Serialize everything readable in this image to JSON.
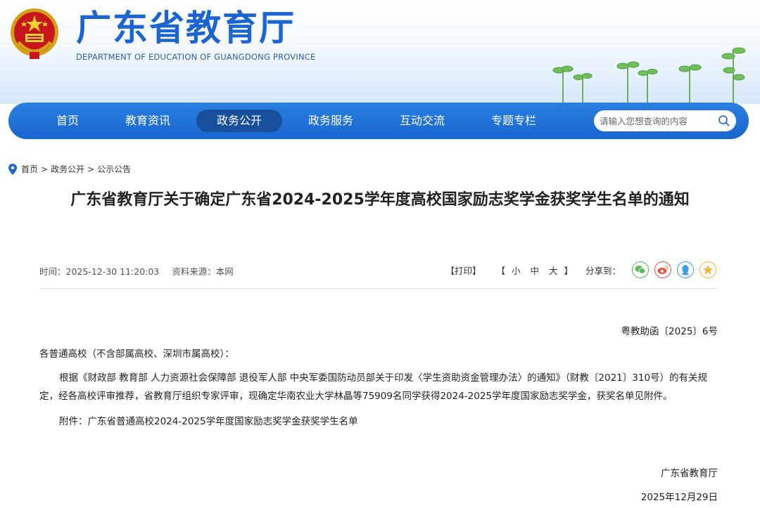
{
  "header": {
    "title": "广东省教育厅",
    "subtitle": "DEPARTMENT OF EDUCATION OF GUANGDONG PROVINCE"
  },
  "nav": {
    "items": [
      {
        "label": "首页"
      },
      {
        "label": "教育资讯"
      },
      {
        "label": "政务公开"
      },
      {
        "label": "政务服务"
      },
      {
        "label": "互动交流"
      },
      {
        "label": "专题专栏"
      }
    ],
    "active": "政务公开",
    "search_placeholder": "请输入您想查询的内容"
  },
  "breadcrumb": {
    "items": [
      "首页",
      "政务公开",
      "公示公告"
    ],
    "separator": ">"
  },
  "article": {
    "title": "广东省教育厅关于确定广东省2024-2025学年度高校国家励志奖学金获奖学生名单的通知",
    "time": "时间：2025-12-30 11:20:03",
    "source": "资料来源：本网",
    "print_label": "【打印】",
    "size_open": "【",
    "size_small": "小",
    "size_medium": "中",
    "size_large": "大",
    "size_close": "】",
    "share_label": "分享到：",
    "doc_number": "粤教助函〔2025〕6号",
    "salutation": "各普通高校（不含部属高校、深圳市属高校）：",
    "body": "根据《财政部 教育部 人力资源社会保障部 退役军人部 中央军委国防动员部关于印发〈学生资助资金管理办法〉的通知》（财教〔2021〕310号）的有关规定，经各高校评审推荐，省教育厅组织专家评审，现确定华南农业大学林晶等75909名同学获得2024-2025学年度国家励志奖学金，获奖名单见附件。",
    "attachment": "附件：广东省普通高校2024-2025学年度国家励志奖学金获奖学生名单",
    "signature_org": "广东省教育厅",
    "signature_date": "2025年12月29日"
  },
  "colors": {
    "brand_blue": "#1b64d2",
    "nav_active": "#174f9c",
    "wechat": "#5cb85c",
    "weibo": "#e8553f",
    "qq": "#3b9ee6",
    "qzone": "#f2b53a"
  },
  "icons": [
    "national-emblem-icon",
    "search-icon",
    "location-pin-icon",
    "wechat-icon",
    "weibo-icon",
    "qq-icon",
    "qzone-icon"
  ]
}
